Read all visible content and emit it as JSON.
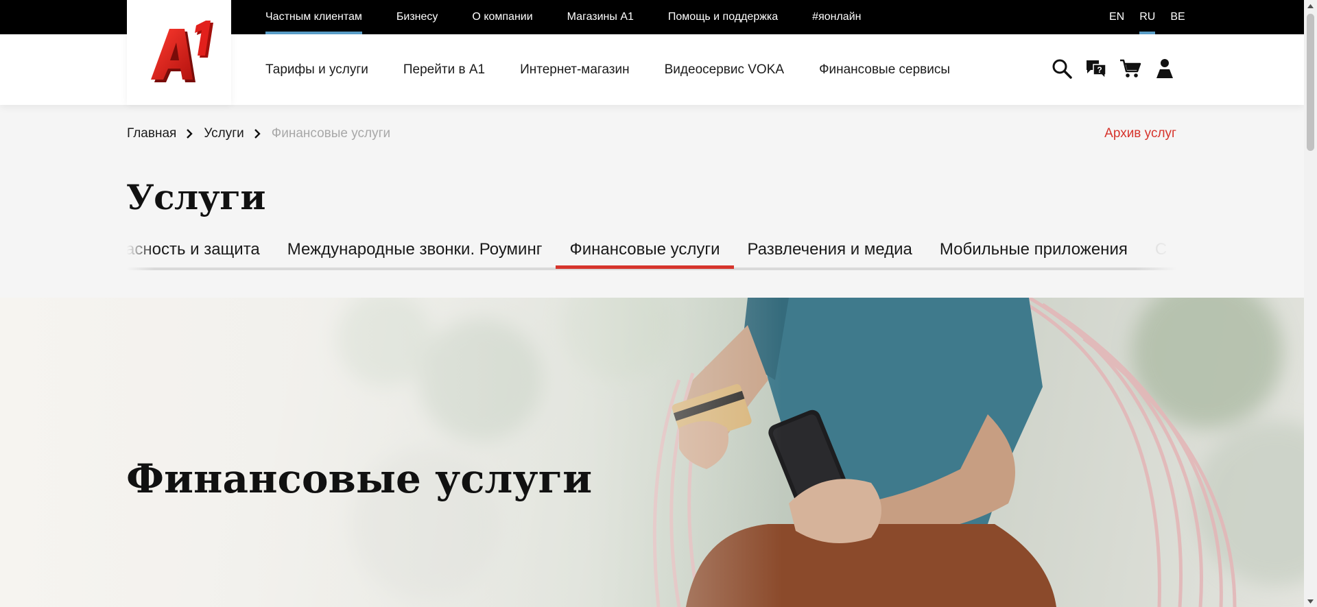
{
  "top_nav": {
    "items": [
      "Частным клиентам",
      "Бизнесу",
      "О компании",
      "Магазины А1",
      "Помощь и поддержка",
      "#яонлайн"
    ],
    "active_index": 0
  },
  "languages": {
    "items": [
      "EN",
      "RU",
      "BE"
    ],
    "active": "RU"
  },
  "logo": {
    "text": "A1",
    "brand_color": "#e2201c"
  },
  "main_nav": {
    "items": [
      "Тарифы и услуги",
      "Перейти в А1",
      "Интернет-магазин",
      "Видеосервис VOKA",
      "Финансовые сервисы"
    ]
  },
  "header_icons": [
    "search-icon",
    "help-chat-icon",
    "cart-icon",
    "user-icon"
  ],
  "breadcrumb": {
    "items": [
      "Главная",
      "Услуги",
      "Финансовые услуги"
    ]
  },
  "archive_link": "Архив услуг",
  "page_title": "Услуги",
  "tabs": {
    "items": [
      "асность и защита",
      "Международные звонки. Роуминг",
      "Финансовые услуги",
      "Развлечения и медиа",
      "Мобильные приложения",
      "С"
    ],
    "active_index": 2
  },
  "hero": {
    "title": "Финансовые услуги"
  },
  "colors": {
    "accent_red": "#d6342c",
    "active_blue": "#5a9ec8",
    "topbar": "#000000"
  }
}
